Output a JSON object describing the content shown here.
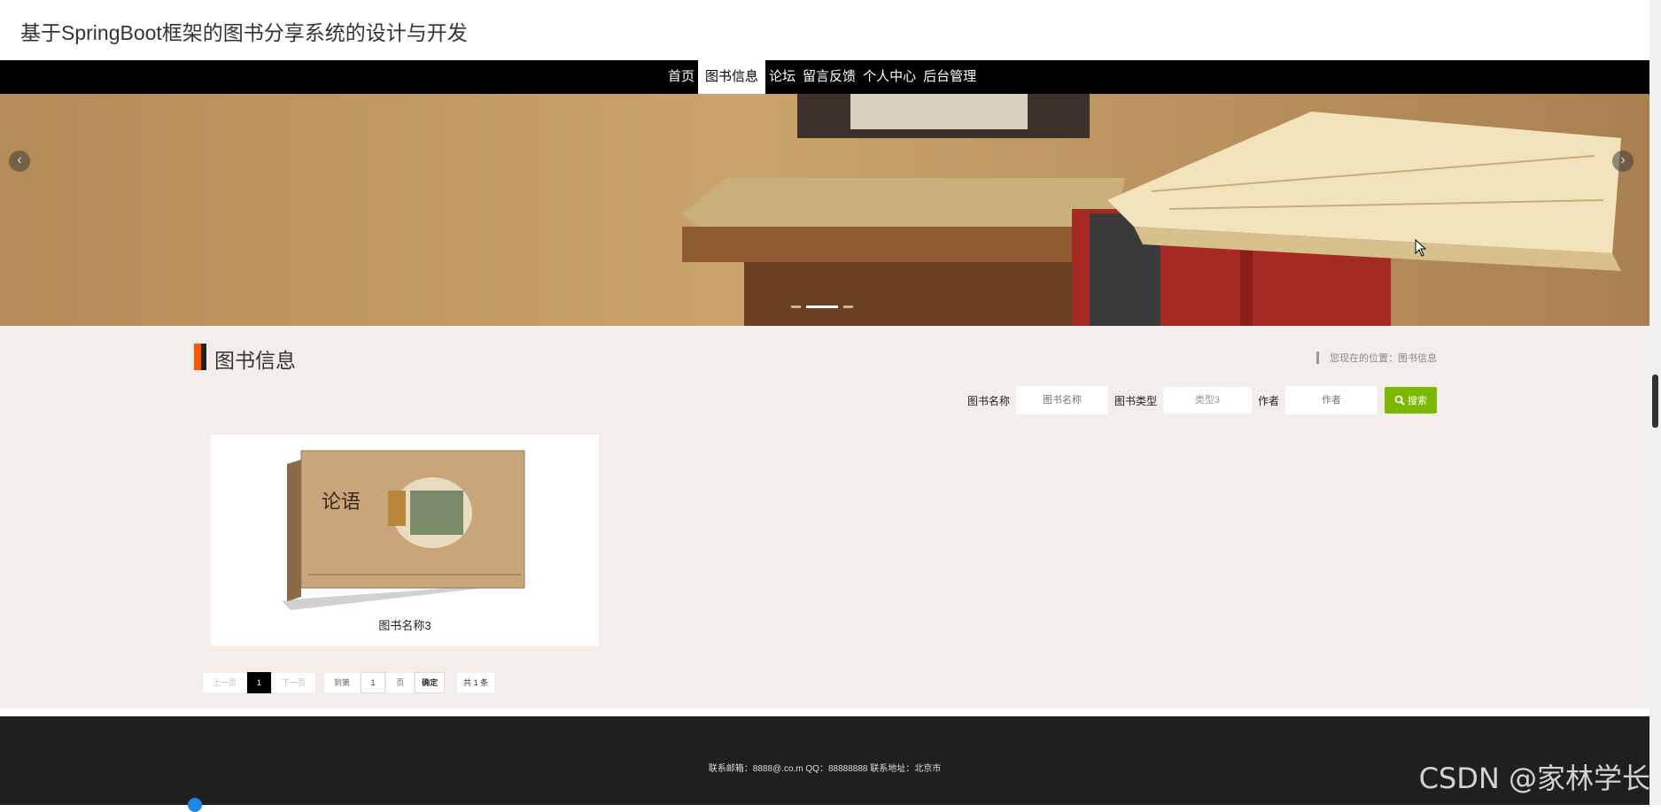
{
  "header": {
    "title": "基于SpringBoot框架的图书分享系统的设计与开发"
  },
  "nav": {
    "items": [
      {
        "label": "首页",
        "active": false
      },
      {
        "label": "图书信息",
        "active": true
      },
      {
        "label": "论坛",
        "active": false
      },
      {
        "label": "留言反馈",
        "active": false
      },
      {
        "label": "个人中心",
        "active": false
      },
      {
        "label": "后台管理",
        "active": false
      }
    ]
  },
  "banner": {
    "slide_count": 3,
    "active_slide": 2
  },
  "section": {
    "title": "图书信息",
    "breadcrumb": "您现在的位置：图书信息"
  },
  "search": {
    "name_label": "图书名称",
    "name_placeholder": "图书名称",
    "type_label": "图书类型",
    "type_value": "类型3",
    "author_label": "作者",
    "author_placeholder": "作者",
    "button_label": "搜索"
  },
  "books": [
    {
      "title": "图书名称3",
      "cover_title": "论语"
    }
  ],
  "pagination": {
    "prev": "上一页",
    "current_page": "1",
    "next": "下一页",
    "goto_prefix": "到第",
    "goto_value": "1",
    "goto_suffix": "页",
    "confirm": "确定",
    "total": "共 1 条"
  },
  "footer": {
    "contact": "联系邮箱：8888@.co.m QQ：88888888 联系地址：北京市"
  },
  "watermark": "CSDN @家林学长",
  "colors": {
    "nav_bg": "#000000",
    "accent_orange": "#ff5500",
    "search_green": "#7ab900",
    "footer_bg": "#1f1f1f",
    "content_bg": "#f4eeea"
  }
}
